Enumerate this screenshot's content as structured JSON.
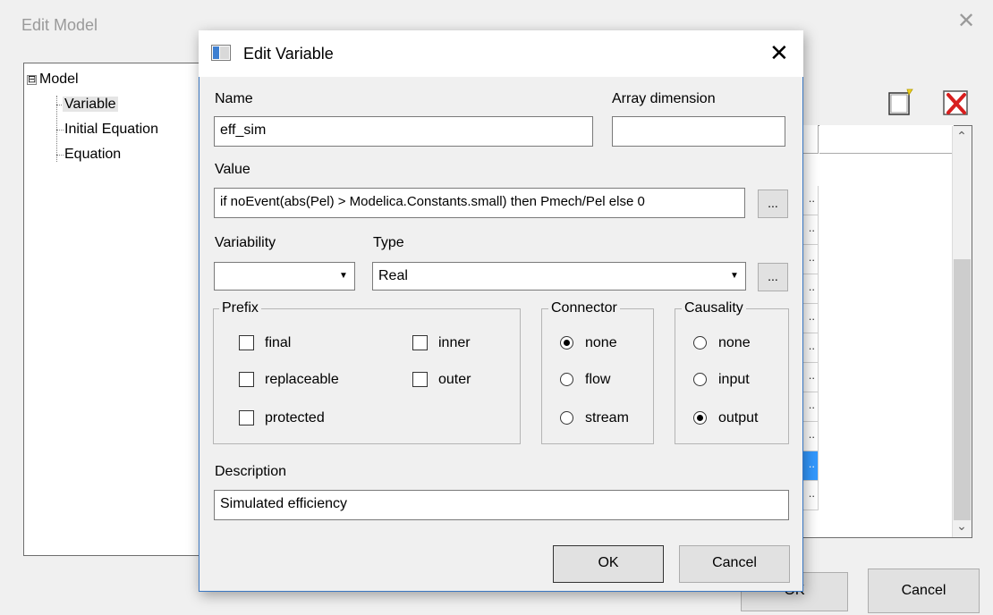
{
  "background_window": {
    "title": "Edit Model",
    "close_glyph": "✕",
    "tree": {
      "root": "Model",
      "expander": "⊟",
      "children": [
        "Variable",
        "Initial Equation",
        "Equation"
      ]
    },
    "list_row_marks": [
      "..",
      "..",
      "..",
      "..",
      "..",
      "..",
      "..",
      "..",
      "..",
      "..",
      "..",
      ".."
    ],
    "scroll_up_glyph": "⌃",
    "scroll_down_glyph": "⌄",
    "ok_label": "OK",
    "cancel_label": "Cancel",
    "icons": {
      "new": "new-item-icon",
      "delete": "delete-x-icon"
    }
  },
  "dialog": {
    "title": "Edit Variable",
    "close_glyph": "✕",
    "name_label": "Name",
    "name_value": "eff_sim",
    "array_label": "Array dimension",
    "array_value": "",
    "value_label": "Value",
    "value_value": "if noEvent(abs(Pel) > Modelica.Constants.small) then Pmech/Pel else 0",
    "ellipsis": "...",
    "variability_label": "Variability",
    "variability_value": "",
    "type_label": "Type",
    "type_value": "Real",
    "prefix": {
      "title": "Prefix",
      "options": [
        {
          "label": "final",
          "checked": false
        },
        {
          "label": "replaceable",
          "checked": false
        },
        {
          "label": "protected",
          "checked": false
        },
        {
          "label": "inner",
          "checked": false
        },
        {
          "label": "outer",
          "checked": false
        }
      ]
    },
    "connector": {
      "title": "Connector",
      "options": [
        {
          "label": "none",
          "selected": true
        },
        {
          "label": "flow",
          "selected": false
        },
        {
          "label": "stream",
          "selected": false
        }
      ]
    },
    "causality": {
      "title": "Causality",
      "options": [
        {
          "label": "none",
          "selected": false
        },
        {
          "label": "input",
          "selected": false
        },
        {
          "label": "output",
          "selected": true
        }
      ]
    },
    "description_label": "Description",
    "description_value": "Simulated efficiency",
    "ok_label": "OK",
    "cancel_label": "Cancel"
  },
  "colors": {
    "dialog_border": "#3a77c2",
    "selection": "#3399ff",
    "background": "#f0f0f0"
  }
}
